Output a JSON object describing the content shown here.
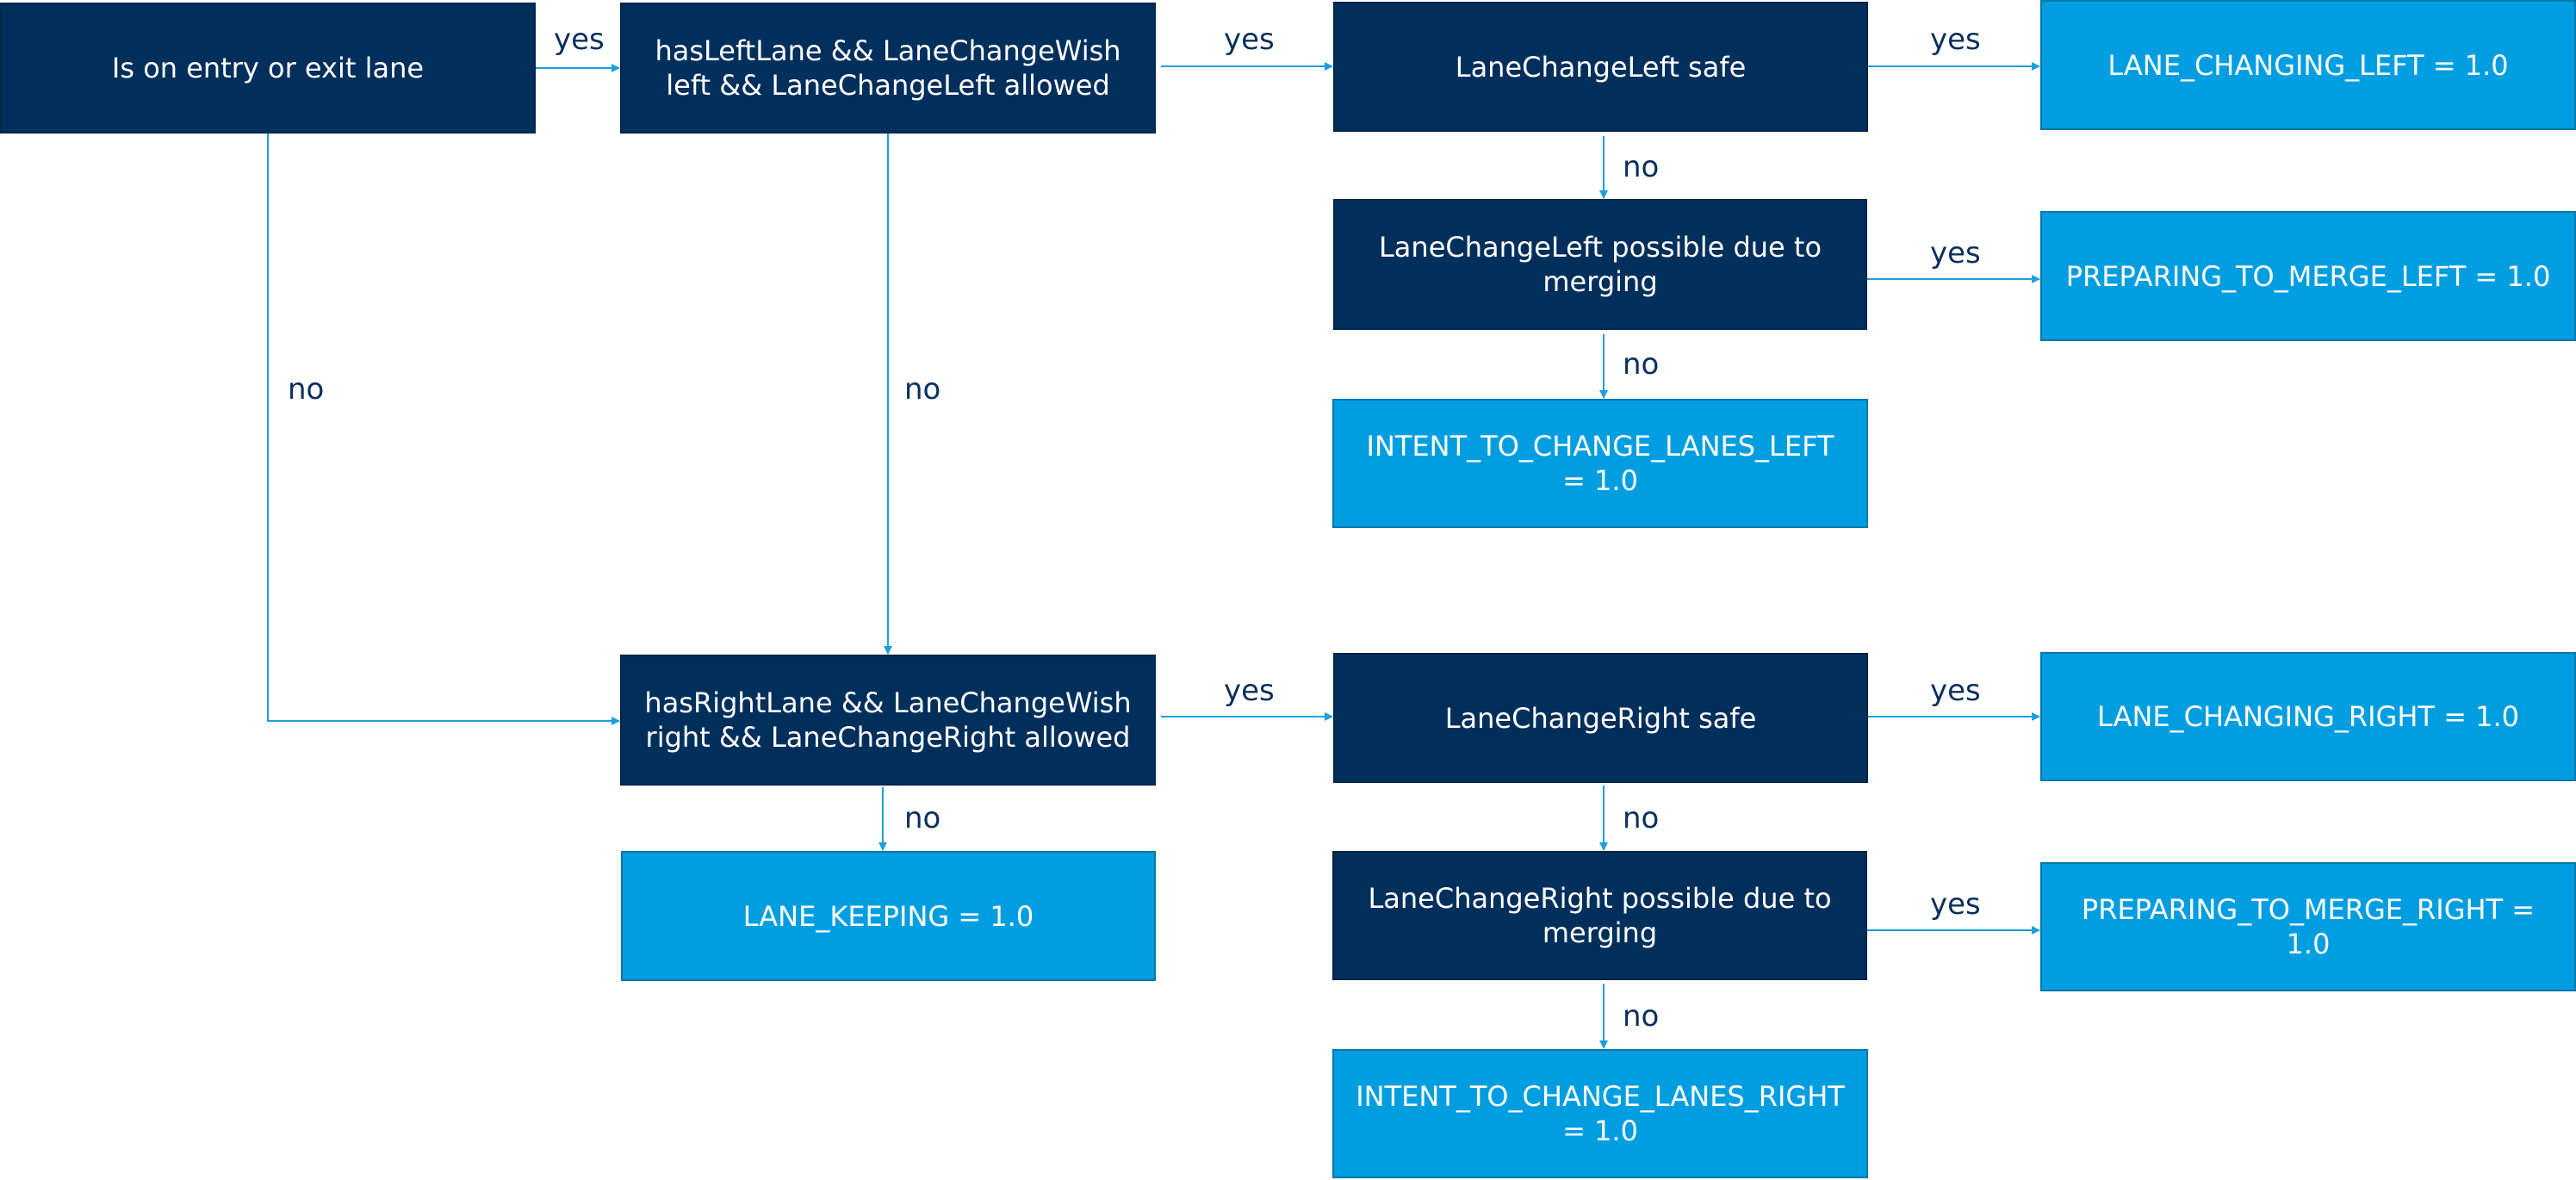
{
  "diagram": {
    "colors": {
      "decision_fill": "#002f5c",
      "result_fill": "#009ee0",
      "edge": "#1a9fde",
      "edge_label": "#0a2f5c"
    },
    "nodes": {
      "entry_exit": "Is on entry or exit lane",
      "left_wish": "hasLeftLane && LaneChangeWish left && LaneChangeLeft allowed",
      "left_safe": "LaneChangeLeft safe",
      "lane_changing_left": "LANE_CHANGING_LEFT = 1.0",
      "left_merge_possible": "LaneChangeLeft possible due to merging",
      "preparing_merge_left": "PREPARING_TO_MERGE_LEFT = 1.0",
      "intent_left": "INTENT_TO_CHANGE_LANES_LEFT = 1.0",
      "right_wish": "hasRightLane && LaneChangeWish right && LaneChangeRight allowed",
      "right_safe": "LaneChangeRight safe",
      "lane_changing_right": "LANE_CHANGING_RIGHT = 1.0",
      "lane_keeping": "LANE_KEEPING = 1.0",
      "right_merge_possible": "LaneChangeRight possible due to merging",
      "preparing_merge_right": "PREPARING_TO_MERGE_RIGHT = 1.0",
      "intent_right": "INTENT_TO_CHANGE_LANES_RIGHT = 1.0"
    },
    "edges": [
      {
        "from": "entry_exit",
        "to": "left_wish",
        "label": "yes"
      },
      {
        "from": "entry_exit",
        "to": "right_wish",
        "label": "no"
      },
      {
        "from": "left_wish",
        "to": "left_safe",
        "label": "yes"
      },
      {
        "from": "left_wish",
        "to": "right_wish",
        "label": "no"
      },
      {
        "from": "left_safe",
        "to": "lane_changing_left",
        "label": "yes"
      },
      {
        "from": "left_safe",
        "to": "left_merge_possible",
        "label": "no"
      },
      {
        "from": "left_merge_possible",
        "to": "preparing_merge_left",
        "label": "yes"
      },
      {
        "from": "left_merge_possible",
        "to": "intent_left",
        "label": "no"
      },
      {
        "from": "right_wish",
        "to": "right_safe",
        "label": "yes"
      },
      {
        "from": "right_wish",
        "to": "lane_keeping",
        "label": "no"
      },
      {
        "from": "right_safe",
        "to": "lane_changing_right",
        "label": "yes"
      },
      {
        "from": "right_safe",
        "to": "right_merge_possible",
        "label": "no"
      },
      {
        "from": "right_merge_possible",
        "to": "preparing_merge_right",
        "label": "yes"
      },
      {
        "from": "right_merge_possible",
        "to": "intent_right",
        "label": "no"
      }
    ]
  }
}
